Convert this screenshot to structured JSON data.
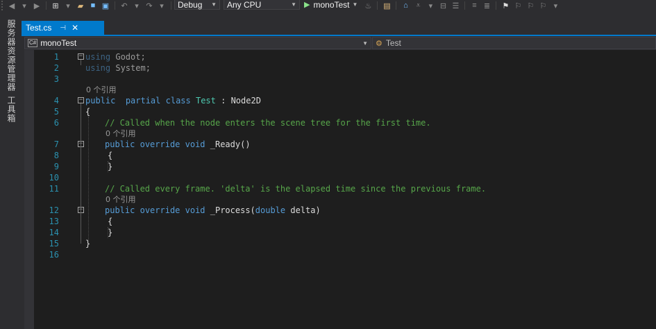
{
  "toolbar": {
    "config": "Debug",
    "platform": "Any CPU",
    "run_target": "monoTest"
  },
  "side_panels": [
    "服务器资源管理器",
    "工具箱"
  ],
  "tab": {
    "name": "Test.cs",
    "pin_glyph": "⊣",
    "close_glyph": "✕"
  },
  "nav": {
    "project": "monoTest",
    "lang_badge": "C#",
    "member": "Test"
  },
  "editor": {
    "lines": [
      {
        "n": "1",
        "tokens": [
          [
            "using-kw",
            "using"
          ],
          [
            "dim",
            " Godot;"
          ]
        ],
        "fold": "−"
      },
      {
        "n": "2",
        "tokens": [
          [
            "using-kw",
            "using"
          ],
          [
            "dim",
            " System;"
          ]
        ]
      },
      {
        "n": "3",
        "tokens": []
      },
      {
        "n": "4",
        "tokens": [
          [
            "kw",
            "public"
          ],
          [
            "",
            "  "
          ],
          [
            "kw",
            "partial"
          ],
          [
            "",
            " "
          ],
          [
            "kw",
            "class"
          ],
          [
            "",
            " "
          ],
          [
            "cls",
            "Test"
          ],
          [
            "",
            " : "
          ],
          [
            "",
            "Node2D"
          ]
        ],
        "fold": "−",
        "lens": "0 个引用"
      },
      {
        "n": "5",
        "tokens": [
          [
            "",
            "{"
          ]
        ]
      },
      {
        "n": "6",
        "tokens": [
          [
            "cmt",
            "// Called when the node enters the scene tree for the first time."
          ]
        ]
      },
      {
        "n": "7",
        "tokens": [
          [
            "kw",
            "public"
          ],
          [
            "",
            " "
          ],
          [
            "kw",
            "override"
          ],
          [
            "",
            " "
          ],
          [
            "kw",
            "void"
          ],
          [
            "",
            " _Ready()"
          ]
        ],
        "fold": "−",
        "lens": "0 个引用"
      },
      {
        "n": "8",
        "tokens": [
          [
            "",
            "{"
          ]
        ]
      },
      {
        "n": "9",
        "tokens": [
          [
            "",
            "}"
          ]
        ]
      },
      {
        "n": "10",
        "tokens": []
      },
      {
        "n": "11",
        "tokens": [
          [
            "cmt",
            "// Called every frame. 'delta' is the elapsed time since the previous frame."
          ]
        ]
      },
      {
        "n": "12",
        "tokens": [
          [
            "kw",
            "public"
          ],
          [
            "",
            " "
          ],
          [
            "kw",
            "override"
          ],
          [
            "",
            " "
          ],
          [
            "kw",
            "void"
          ],
          [
            "",
            " _Process("
          ],
          [
            "kw",
            "double"
          ],
          [
            "",
            " delta)"
          ]
        ],
        "fold": "−",
        "lens": "0 个引用"
      },
      {
        "n": "13",
        "tokens": [
          [
            "",
            "{"
          ]
        ]
      },
      {
        "n": "14",
        "tokens": [
          [
            "",
            "}"
          ]
        ]
      },
      {
        "n": "15",
        "tokens": [
          [
            "",
            "}"
          ]
        ]
      },
      {
        "n": "16",
        "tokens": []
      }
    ]
  },
  "colors": {
    "accent": "#007acc",
    "editor_bg": "#1e1e1e",
    "keyword": "#569cd6",
    "comment": "#57a64a",
    "line_number": "#2b91af"
  }
}
